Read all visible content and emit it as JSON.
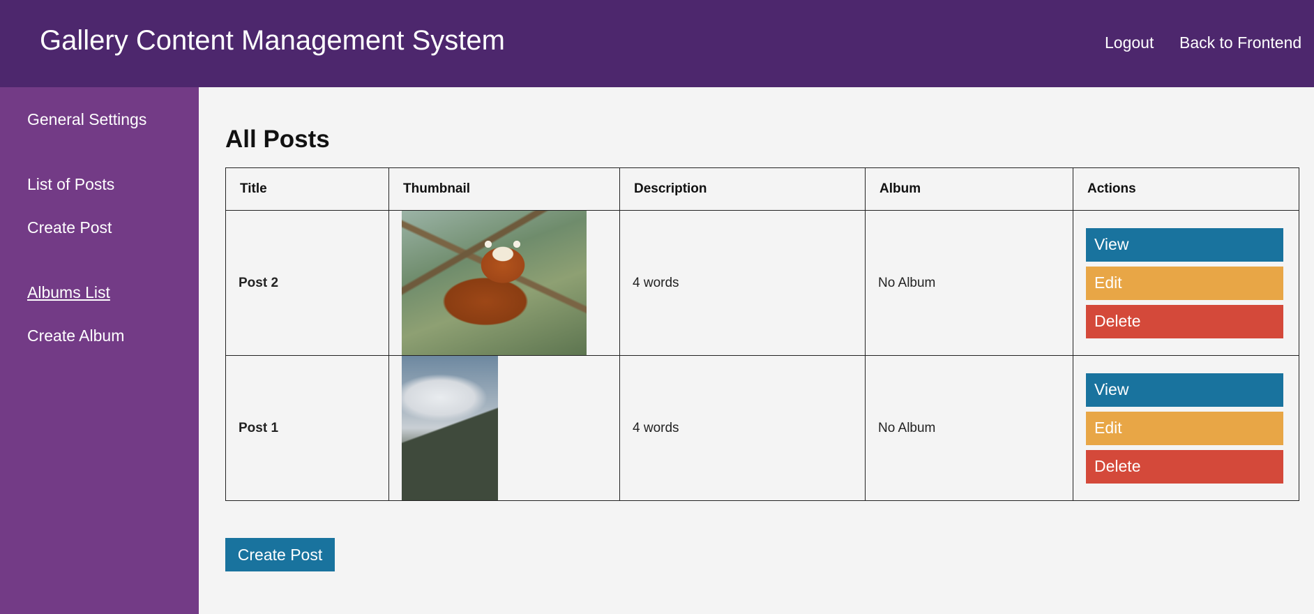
{
  "header": {
    "title": "Gallery Content Management System",
    "links": [
      {
        "label": "Logout"
      },
      {
        "label": "Back to Frontend"
      }
    ]
  },
  "sidebar": {
    "items": [
      {
        "label": "General Settings"
      },
      {
        "label": "List of Posts"
      },
      {
        "label": "Create Post"
      },
      {
        "label": "Albums List",
        "active": true
      },
      {
        "label": "Create Album"
      }
    ]
  },
  "main": {
    "title": "All Posts",
    "columns": [
      "Title",
      "Thumbnail",
      "Description",
      "Album",
      "Actions"
    ],
    "rows": [
      {
        "title": "Post 2",
        "thumbnail": "red-panda-photo",
        "description": "4 words",
        "album": "No Album"
      },
      {
        "title": "Post 1",
        "thumbnail": "misty-mountain-photo",
        "description": "4 words",
        "album": "No Album"
      }
    ],
    "actions": {
      "view": "View",
      "edit": "Edit",
      "delete": "Delete"
    },
    "create_button": "Create Post"
  },
  "colors": {
    "header_bg": "#4d276d",
    "sidebar_bg": "#733b86",
    "page_bg": "#f4f4f4",
    "view_btn": "#19739e",
    "edit_btn": "#e8a646",
    "delete_btn": "#d4493a"
  }
}
